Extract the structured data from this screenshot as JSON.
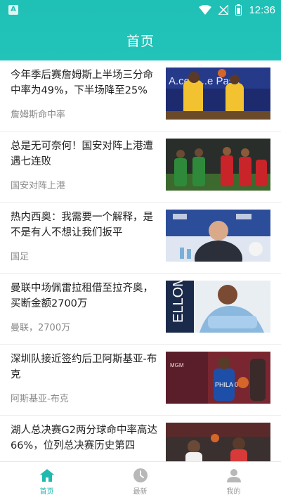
{
  "status_bar": {
    "time": "12:36",
    "app_badge": "A",
    "icons": [
      "wifi-icon",
      "signal-off-icon",
      "battery-icon"
    ]
  },
  "header": {
    "title": "首页"
  },
  "news": [
    {
      "headline": "今年季后赛詹姆斯上半场三分命中率为49%，下半场降至25%",
      "tag": "詹姆斯命中率",
      "image_text": "A.com...e Pass"
    },
    {
      "headline": "总是无可奈何！国安对阵上港遭遇七连败",
      "tag": "国安对阵上港",
      "image_text": ""
    },
    {
      "headline": "热内西奥：我需要一个解释，是不是有人不想让我们扳平",
      "tag": "国足",
      "image_text": ""
    },
    {
      "headline": "曼联中场佩雷拉租借至拉齐奥，买断金额2700万",
      "tag": "曼联，2700万",
      "image_text": "ELLOM"
    },
    {
      "headline": "深圳队接近签约后卫阿斯基亚-布克",
      "tag": "阿斯基亚-布克",
      "image_text": "PHILA 00"
    },
    {
      "headline": "湖人总决赛G2两分球命中率高达66%，位列总决赛历史第四",
      "tag": "",
      "image_text": ""
    }
  ],
  "tabbar": {
    "tabs": [
      {
        "label": "首页",
        "icon": "home-icon",
        "active": true
      },
      {
        "label": "最新",
        "icon": "clock-icon",
        "active": false
      },
      {
        "label": "我的",
        "icon": "user-icon",
        "active": false
      }
    ]
  },
  "colors": {
    "accent": "#1fc0b6",
    "text": "#222222",
    "muted": "#8a8a8a",
    "tab_inactive": "#9b9b9b"
  }
}
